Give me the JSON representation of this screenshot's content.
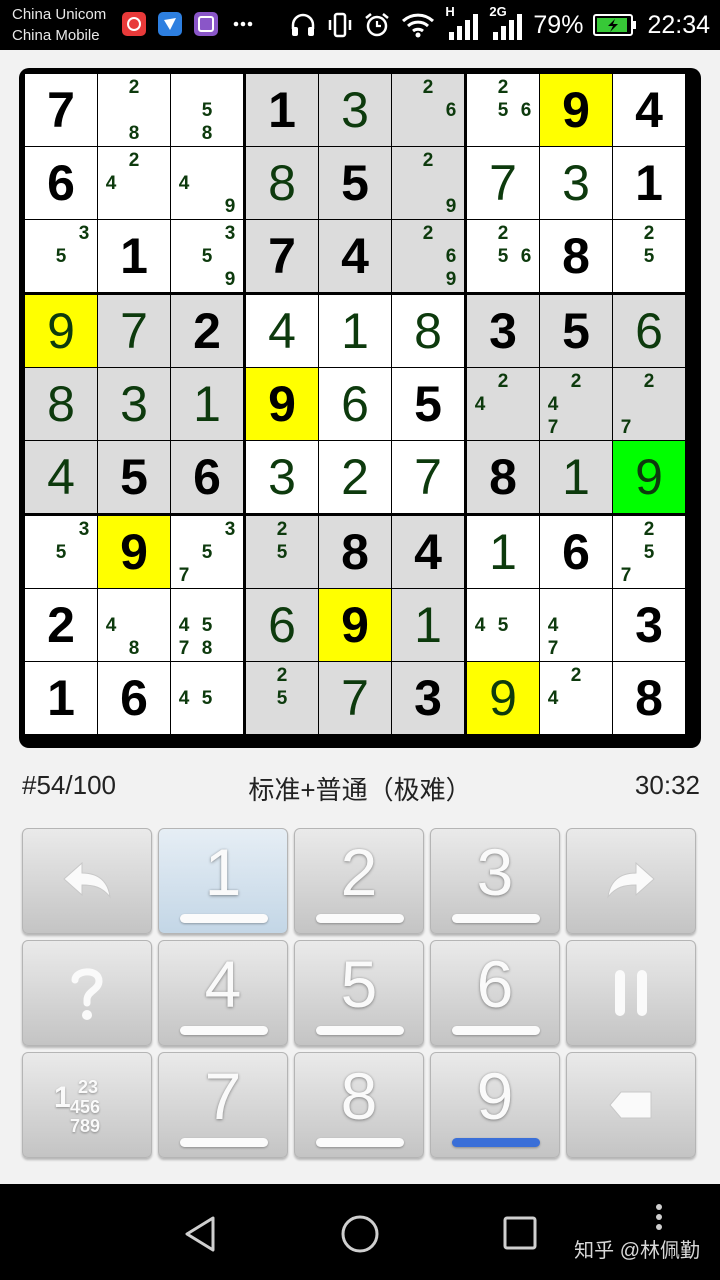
{
  "status_bar": {
    "carrier_1": "China Unicom",
    "carrier_2": "China Mobile",
    "network_h": "H",
    "network_2g": "2G",
    "battery": "79%",
    "time": "22:34",
    "icons": [
      "netease-music-icon",
      "feishu-icon",
      "gallery-app-icon",
      "more-dots-icon",
      "headphones-icon",
      "vibrate-icon",
      "alarm-icon",
      "wifi-icon",
      "signal-icon",
      "battery-charging-icon"
    ]
  },
  "board": {
    "rows": [
      "7    1 3  9 4",
      "",
      ""
    ],
    "cells": [
      [
        {
          "v": "7",
          "t": "g",
          "bg": "white"
        },
        {
          "n": "28",
          "bg": "white"
        },
        {
          "n": "58",
          "bg": "white"
        },
        {
          "v": "1",
          "t": "g",
          "bg": "gray"
        },
        {
          "v": "3",
          "t": "u",
          "bg": "gray"
        },
        {
          "n": "26",
          "bg": "gray"
        },
        {
          "n": "256",
          "bg": "white"
        },
        {
          "v": "9",
          "t": "g",
          "bg": "yellow"
        },
        {
          "v": "4",
          "t": "g",
          "bg": "white"
        }
      ],
      [
        {
          "v": "6",
          "t": "g",
          "bg": "white"
        },
        {
          "n": "24",
          "bg": "white"
        },
        {
          "n": "49",
          "bg": "white"
        },
        {
          "v": "8",
          "t": "u",
          "bg": "gray"
        },
        {
          "v": "5",
          "t": "g",
          "bg": "gray"
        },
        {
          "n": "29",
          "bg": "gray"
        },
        {
          "v": "7",
          "t": "u",
          "bg": "white"
        },
        {
          "v": "3",
          "t": "u",
          "bg": "white"
        },
        {
          "v": "1",
          "t": "g",
          "bg": "white"
        }
      ],
      [
        {
          "n": "35",
          "bg": "white"
        },
        {
          "v": "1",
          "t": "g",
          "bg": "white"
        },
        {
          "n": "359",
          "bg": "white"
        },
        {
          "v": "7",
          "t": "g",
          "bg": "gray"
        },
        {
          "v": "4",
          "t": "g",
          "bg": "gray"
        },
        {
          "n": "269",
          "bg": "gray"
        },
        {
          "n": "256",
          "bg": "white"
        },
        {
          "v": "8",
          "t": "g",
          "bg": "white"
        },
        {
          "n": "25",
          "bg": "white"
        }
      ],
      [
        {
          "v": "9",
          "t": "u",
          "bg": "yellow"
        },
        {
          "v": "7",
          "t": "u",
          "bg": "gray"
        },
        {
          "v": "2",
          "t": "g",
          "bg": "gray"
        },
        {
          "v": "4",
          "t": "u",
          "bg": "white"
        },
        {
          "v": "1",
          "t": "u",
          "bg": "white"
        },
        {
          "v": "8",
          "t": "u",
          "bg": "white"
        },
        {
          "v": "3",
          "t": "g",
          "bg": "gray"
        },
        {
          "v": "5",
          "t": "g",
          "bg": "gray"
        },
        {
          "v": "6",
          "t": "u",
          "bg": "gray"
        }
      ],
      [
        {
          "v": "8",
          "t": "u",
          "bg": "gray"
        },
        {
          "v": "3",
          "t": "u",
          "bg": "gray"
        },
        {
          "v": "1",
          "t": "u",
          "bg": "gray"
        },
        {
          "v": "9",
          "t": "g",
          "bg": "yellow"
        },
        {
          "v": "6",
          "t": "u",
          "bg": "white"
        },
        {
          "v": "5",
          "t": "g",
          "bg": "white"
        },
        {
          "n": "24",
          "bg": "gray"
        },
        {
          "n": "247",
          "bg": "gray"
        },
        {
          "n": "27",
          "bg": "gray"
        }
      ],
      [
        {
          "v": "4",
          "t": "u",
          "bg": "gray"
        },
        {
          "v": "5",
          "t": "g",
          "bg": "gray"
        },
        {
          "v": "6",
          "t": "g",
          "bg": "gray"
        },
        {
          "v": "3",
          "t": "u",
          "bg": "white"
        },
        {
          "v": "2",
          "t": "u",
          "bg": "white"
        },
        {
          "v": "7",
          "t": "u",
          "bg": "white"
        },
        {
          "v": "8",
          "t": "g",
          "bg": "gray"
        },
        {
          "v": "1",
          "t": "u",
          "bg": "gray"
        },
        {
          "v": "9",
          "t": "u",
          "bg": "green"
        }
      ],
      [
        {
          "n": "35",
          "bg": "white"
        },
        {
          "v": "9",
          "t": "g",
          "bg": "yellow"
        },
        {
          "n": "357",
          "bg": "white"
        },
        {
          "n": "25",
          "bg": "gray"
        },
        {
          "v": "8",
          "t": "g",
          "bg": "gray"
        },
        {
          "v": "4",
          "t": "g",
          "bg": "gray"
        },
        {
          "v": "1",
          "t": "u",
          "bg": "white"
        },
        {
          "v": "6",
          "t": "g",
          "bg": "white"
        },
        {
          "n": "257",
          "bg": "white"
        }
      ],
      [
        {
          "v": "2",
          "t": "g",
          "bg": "white"
        },
        {
          "n": "48",
          "bg": "white"
        },
        {
          "n": "4578",
          "bg": "white"
        },
        {
          "v": "6",
          "t": "u",
          "bg": "gray"
        },
        {
          "v": "9",
          "t": "g",
          "bg": "yellow"
        },
        {
          "v": "1",
          "t": "u",
          "bg": "gray"
        },
        {
          "n": "45",
          "bg": "white"
        },
        {
          "n": "47",
          "bg": "white"
        },
        {
          "v": "3",
          "t": "g",
          "bg": "white"
        }
      ],
      [
        {
          "v": "1",
          "t": "g",
          "bg": "white"
        },
        {
          "v": "6",
          "t": "g",
          "bg": "white"
        },
        {
          "n": "45",
          "bg": "white"
        },
        {
          "n": "25",
          "bg": "gray"
        },
        {
          "v": "7",
          "t": "u",
          "bg": "gray"
        },
        {
          "v": "3",
          "t": "g",
          "bg": "gray"
        },
        {
          "v": "9",
          "t": "u",
          "bg": "yellow"
        },
        {
          "n": "24",
          "bg": "white"
        },
        {
          "v": "8",
          "t": "g",
          "bg": "white"
        }
      ]
    ]
  },
  "info": {
    "puzzle_number": "#54/100",
    "difficulty": "标准+普通（极难）",
    "timer": "30:32"
  },
  "keypad": {
    "keys": [
      {
        "type": "icon",
        "name": "undo-button",
        "icon": "undo-arrow-icon"
      },
      {
        "type": "digit",
        "label": "1",
        "bar": "white",
        "highlight": true
      },
      {
        "type": "digit",
        "label": "2",
        "bar": "white"
      },
      {
        "type": "digit",
        "label": "3",
        "bar": "white"
      },
      {
        "type": "icon",
        "name": "redo-button",
        "icon": "redo-arrow-icon"
      },
      {
        "type": "icon",
        "name": "hint-button",
        "icon": "question-mark-icon"
      },
      {
        "type": "digit",
        "label": "4",
        "bar": "white"
      },
      {
        "type": "digit",
        "label": "5",
        "bar": "white"
      },
      {
        "type": "digit",
        "label": "6",
        "bar": "white"
      },
      {
        "type": "icon",
        "name": "pause-button",
        "icon": "pause-icon"
      },
      {
        "type": "icon",
        "name": "notes-mode-button",
        "icon": "pencil-marks-icon",
        "text_a": "1",
        "text_b": "23",
        "text_c": "456",
        "text_d": "789"
      },
      {
        "type": "digit",
        "label": "7",
        "bar": "white"
      },
      {
        "type": "digit",
        "label": "8",
        "bar": "white"
      },
      {
        "type": "digit",
        "label": "9",
        "bar": "blue"
      },
      {
        "type": "icon",
        "name": "erase-button",
        "icon": "backspace-icon"
      }
    ]
  },
  "navbar": {
    "watermark": "知乎 @林佩勤",
    "icons": [
      "back-triangle-icon",
      "home-circle-icon",
      "recents-square-icon",
      "more-vertical-icon"
    ]
  }
}
